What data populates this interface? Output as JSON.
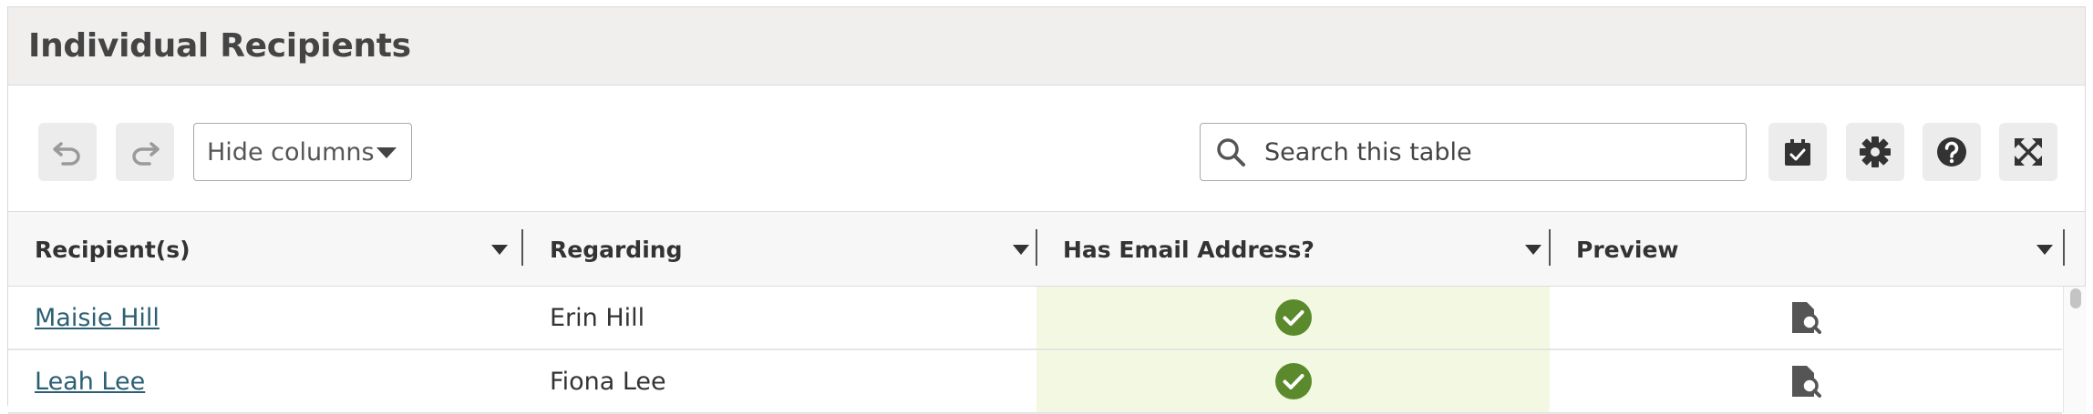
{
  "panel": {
    "title": "Individual Recipients"
  },
  "toolbar": {
    "undo_icon": "undo-icon",
    "redo_icon": "redo-icon",
    "hide_columns_label": "Hide columns",
    "search_placeholder": "Search this table",
    "buttons": [
      "tasks-icon",
      "gear-icon",
      "help-icon",
      "expand-icon"
    ]
  },
  "table": {
    "columns": [
      "Recipient(s)",
      "Regarding",
      "Has Email Address?",
      "Preview"
    ],
    "rows": [
      {
        "recipient": "Maisie Hill",
        "regarding": "Erin Hill",
        "has_email": true,
        "preview_icon": "document-preview-icon"
      },
      {
        "recipient": "Leah Lee",
        "regarding": "Fiona Lee",
        "has_email": true,
        "preview_icon": "document-preview-icon"
      }
    ]
  },
  "colors": {
    "check_green": "#5b8a2c",
    "email_cell_bg": "#f2f8e1",
    "link": "#2b5f73",
    "header_bg": "#f0efee"
  }
}
